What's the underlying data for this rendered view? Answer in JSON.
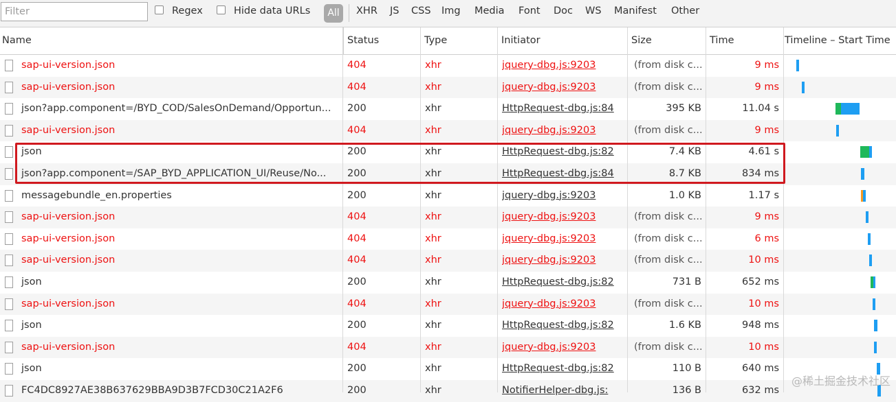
{
  "toolbar": {
    "filter_placeholder": "Filter",
    "regex_label": "Regex",
    "hide_data_urls_label": "Hide data URLs",
    "all_label": "All",
    "types": [
      "XHR",
      "JS",
      "CSS",
      "Img",
      "Media",
      "Font",
      "Doc",
      "WS",
      "Manifest",
      "Other"
    ]
  },
  "columns": {
    "name": "Name",
    "status": "Status",
    "type": "Type",
    "initiator": "Initiator",
    "size": "Size",
    "time": "Time",
    "timeline": "Timeline – Start Time"
  },
  "rows": [
    {
      "name": "sap-ui-version.json",
      "status": "404",
      "type": "xhr",
      "initiator": "jquery-dbg.js:9203",
      "size": "(from disk c...",
      "time": "9 ms",
      "error": true
    },
    {
      "name": "sap-ui-version.json",
      "status": "404",
      "type": "xhr",
      "initiator": "jquery-dbg.js:9203",
      "size": "(from disk c...",
      "time": "9 ms",
      "error": true
    },
    {
      "name": "json?app.component=/BYD_COD/SalesOnDemand/Opportun...",
      "status": "200",
      "type": "xhr",
      "initiator": "HttpRequest-dbg.js:84",
      "size": "395 KB",
      "time": "11.04 s",
      "error": false
    },
    {
      "name": "sap-ui-version.json",
      "status": "404",
      "type": "xhr",
      "initiator": "jquery-dbg.js:9203",
      "size": "(from disk c...",
      "time": "9 ms",
      "error": true
    },
    {
      "name": "json",
      "status": "200",
      "type": "xhr",
      "initiator": "HttpRequest-dbg.js:82",
      "size": "7.4 KB",
      "time": "4.61 s",
      "error": false
    },
    {
      "name": "json?app.component=/SAP_BYD_APPLICATION_UI/Reuse/No...",
      "status": "200",
      "type": "xhr",
      "initiator": "HttpRequest-dbg.js:84",
      "size": "8.7 KB",
      "time": "834 ms",
      "error": false
    },
    {
      "name": "messagebundle_en.properties",
      "status": "200",
      "type": "xhr",
      "initiator": "jquery-dbg.js:9203",
      "size": "1.0 KB",
      "time": "1.17 s",
      "error": false
    },
    {
      "name": "sap-ui-version.json",
      "status": "404",
      "type": "xhr",
      "initiator": "jquery-dbg.js:9203",
      "size": "(from disk c...",
      "time": "9 ms",
      "error": true
    },
    {
      "name": "sap-ui-version.json",
      "status": "404",
      "type": "xhr",
      "initiator": "jquery-dbg.js:9203",
      "size": "(from disk c...",
      "time": "6 ms",
      "error": true
    },
    {
      "name": "sap-ui-version.json",
      "status": "404",
      "type": "xhr",
      "initiator": "jquery-dbg.js:9203",
      "size": "(from disk c...",
      "time": "10 ms",
      "error": true
    },
    {
      "name": "json",
      "status": "200",
      "type": "xhr",
      "initiator": "HttpRequest-dbg.js:82",
      "size": "731 B",
      "time": "652 ms",
      "error": false
    },
    {
      "name": "sap-ui-version.json",
      "status": "404",
      "type": "xhr",
      "initiator": "jquery-dbg.js:9203",
      "size": "(from disk c...",
      "time": "10 ms",
      "error": true
    },
    {
      "name": "json",
      "status": "200",
      "type": "xhr",
      "initiator": "HttpRequest-dbg.js:82",
      "size": "1.6 KB",
      "time": "948 ms",
      "error": false
    },
    {
      "name": "sap-ui-version.json",
      "status": "404",
      "type": "xhr",
      "initiator": "jquery-dbg.js:9203",
      "size": "(from disk c...",
      "time": "10 ms",
      "error": true
    },
    {
      "name": "json",
      "status": "200",
      "type": "xhr",
      "initiator": "HttpRequest-dbg.js:82",
      "size": "110 B",
      "time": "640 ms",
      "error": false
    },
    {
      "name": "FC4DC8927AE38B637629BBA9D3B7FCD30C21A2F6",
      "status": "200",
      "type": "xhr",
      "initiator": "NotifierHelper-dbg.js:",
      "size": "136 B",
      "time": "632 ms",
      "error": false
    }
  ],
  "colors": {
    "error": "#ee1111",
    "waiting": "#1fb85a",
    "download": "#1e9ef2",
    "queued": "#f59a23",
    "highlight": "#d0191f"
  },
  "watermark": "@稀土掘金技术社区"
}
